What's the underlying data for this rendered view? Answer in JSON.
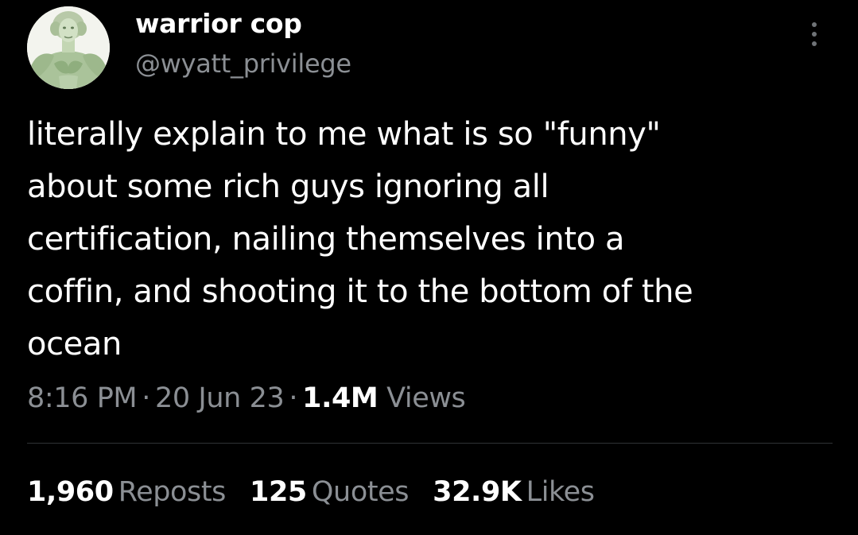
{
  "author": {
    "display_name": "warrior cop",
    "handle": "@wyatt_privilege",
    "avatar": "muscular-george-washington-avatar"
  },
  "tweet": {
    "text_lines": [
      "literally explain to me what is so \"funny\"",
      "about some rich guys ignoring all",
      "certification, nailing themselves into a",
      "coffin, and shooting it to the bottom of the",
      "ocean"
    ]
  },
  "meta": {
    "time": "8:16 PM",
    "date": "20 Jun 23",
    "views_count": "1.4M",
    "views_label": "Views",
    "separator": "·"
  },
  "stats": {
    "reposts_count": "1,960",
    "reposts_label": "Reposts",
    "quotes_count": "125",
    "quotes_label": "Quotes",
    "likes_count": "32.9K",
    "likes_label": "Likes"
  },
  "icons": {
    "more": "more-vertical-icon"
  },
  "colors": {
    "background": "#000000",
    "primary_text": "#ffffff",
    "secondary_text": "#8b8f94",
    "divider": "#2f3336",
    "avatar_tint": "#b5c9a3"
  }
}
